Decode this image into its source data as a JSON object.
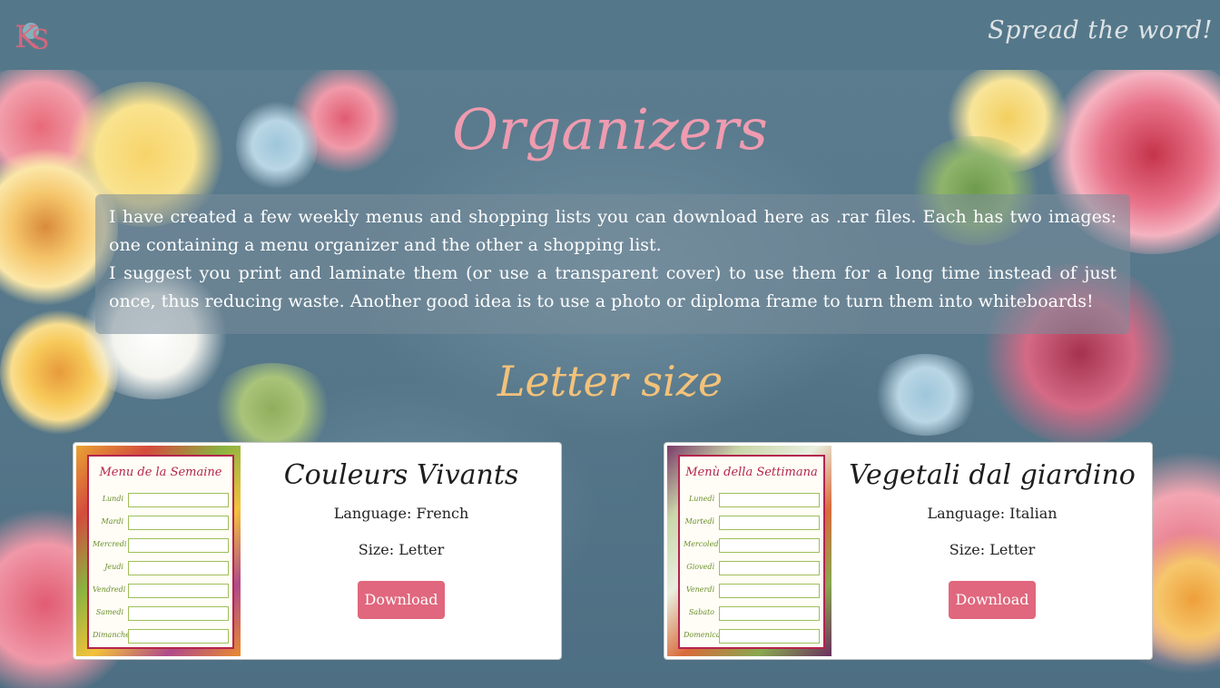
{
  "header": {
    "logo_text": "KS",
    "tagline": "Spread the word!"
  },
  "page_title": "Organizers",
  "intro": {
    "paragraph1": "I have created a few weekly menus and shopping lists you can download here as .rar files. Each has two images: one containing a menu organizer and the other a shopping list.",
    "paragraph2": "I suggest you print and laminate them (or use a transparent cover) to use them for a long time instead of  just once, thus reducing waste. Another good idea is to use a photo or diploma frame to turn them into whiteboards!"
  },
  "section_title": "Letter size",
  "cards": [
    {
      "title": "Couleurs Vivants",
      "language": "Language: French",
      "size": "Size: Letter",
      "button": "Download",
      "thumb": {
        "title": "Menu de la Semaine",
        "days": [
          "Lundi",
          "Mardi",
          "Mercredi",
          "Jeudi",
          "Vendredi",
          "Samedi",
          "Dimanche"
        ]
      }
    },
    {
      "title": "Vegetali dal giardino",
      "language": "Language: Italian",
      "size": "Size: Letter",
      "button": "Download",
      "thumb": {
        "title": "Menù della Settimana",
        "days": [
          "Lunedì",
          "Martedì",
          "Mercoledì",
          "Giovedì",
          "Venerdì",
          "Sabato",
          "Domenica"
        ]
      }
    }
  ],
  "colors": {
    "header_bg": "#54788a",
    "title_pink": "#ef9bb0",
    "section_gold": "#f3c27a",
    "button_bg": "#e0677d",
    "thumb_accent": "#b4244c"
  }
}
